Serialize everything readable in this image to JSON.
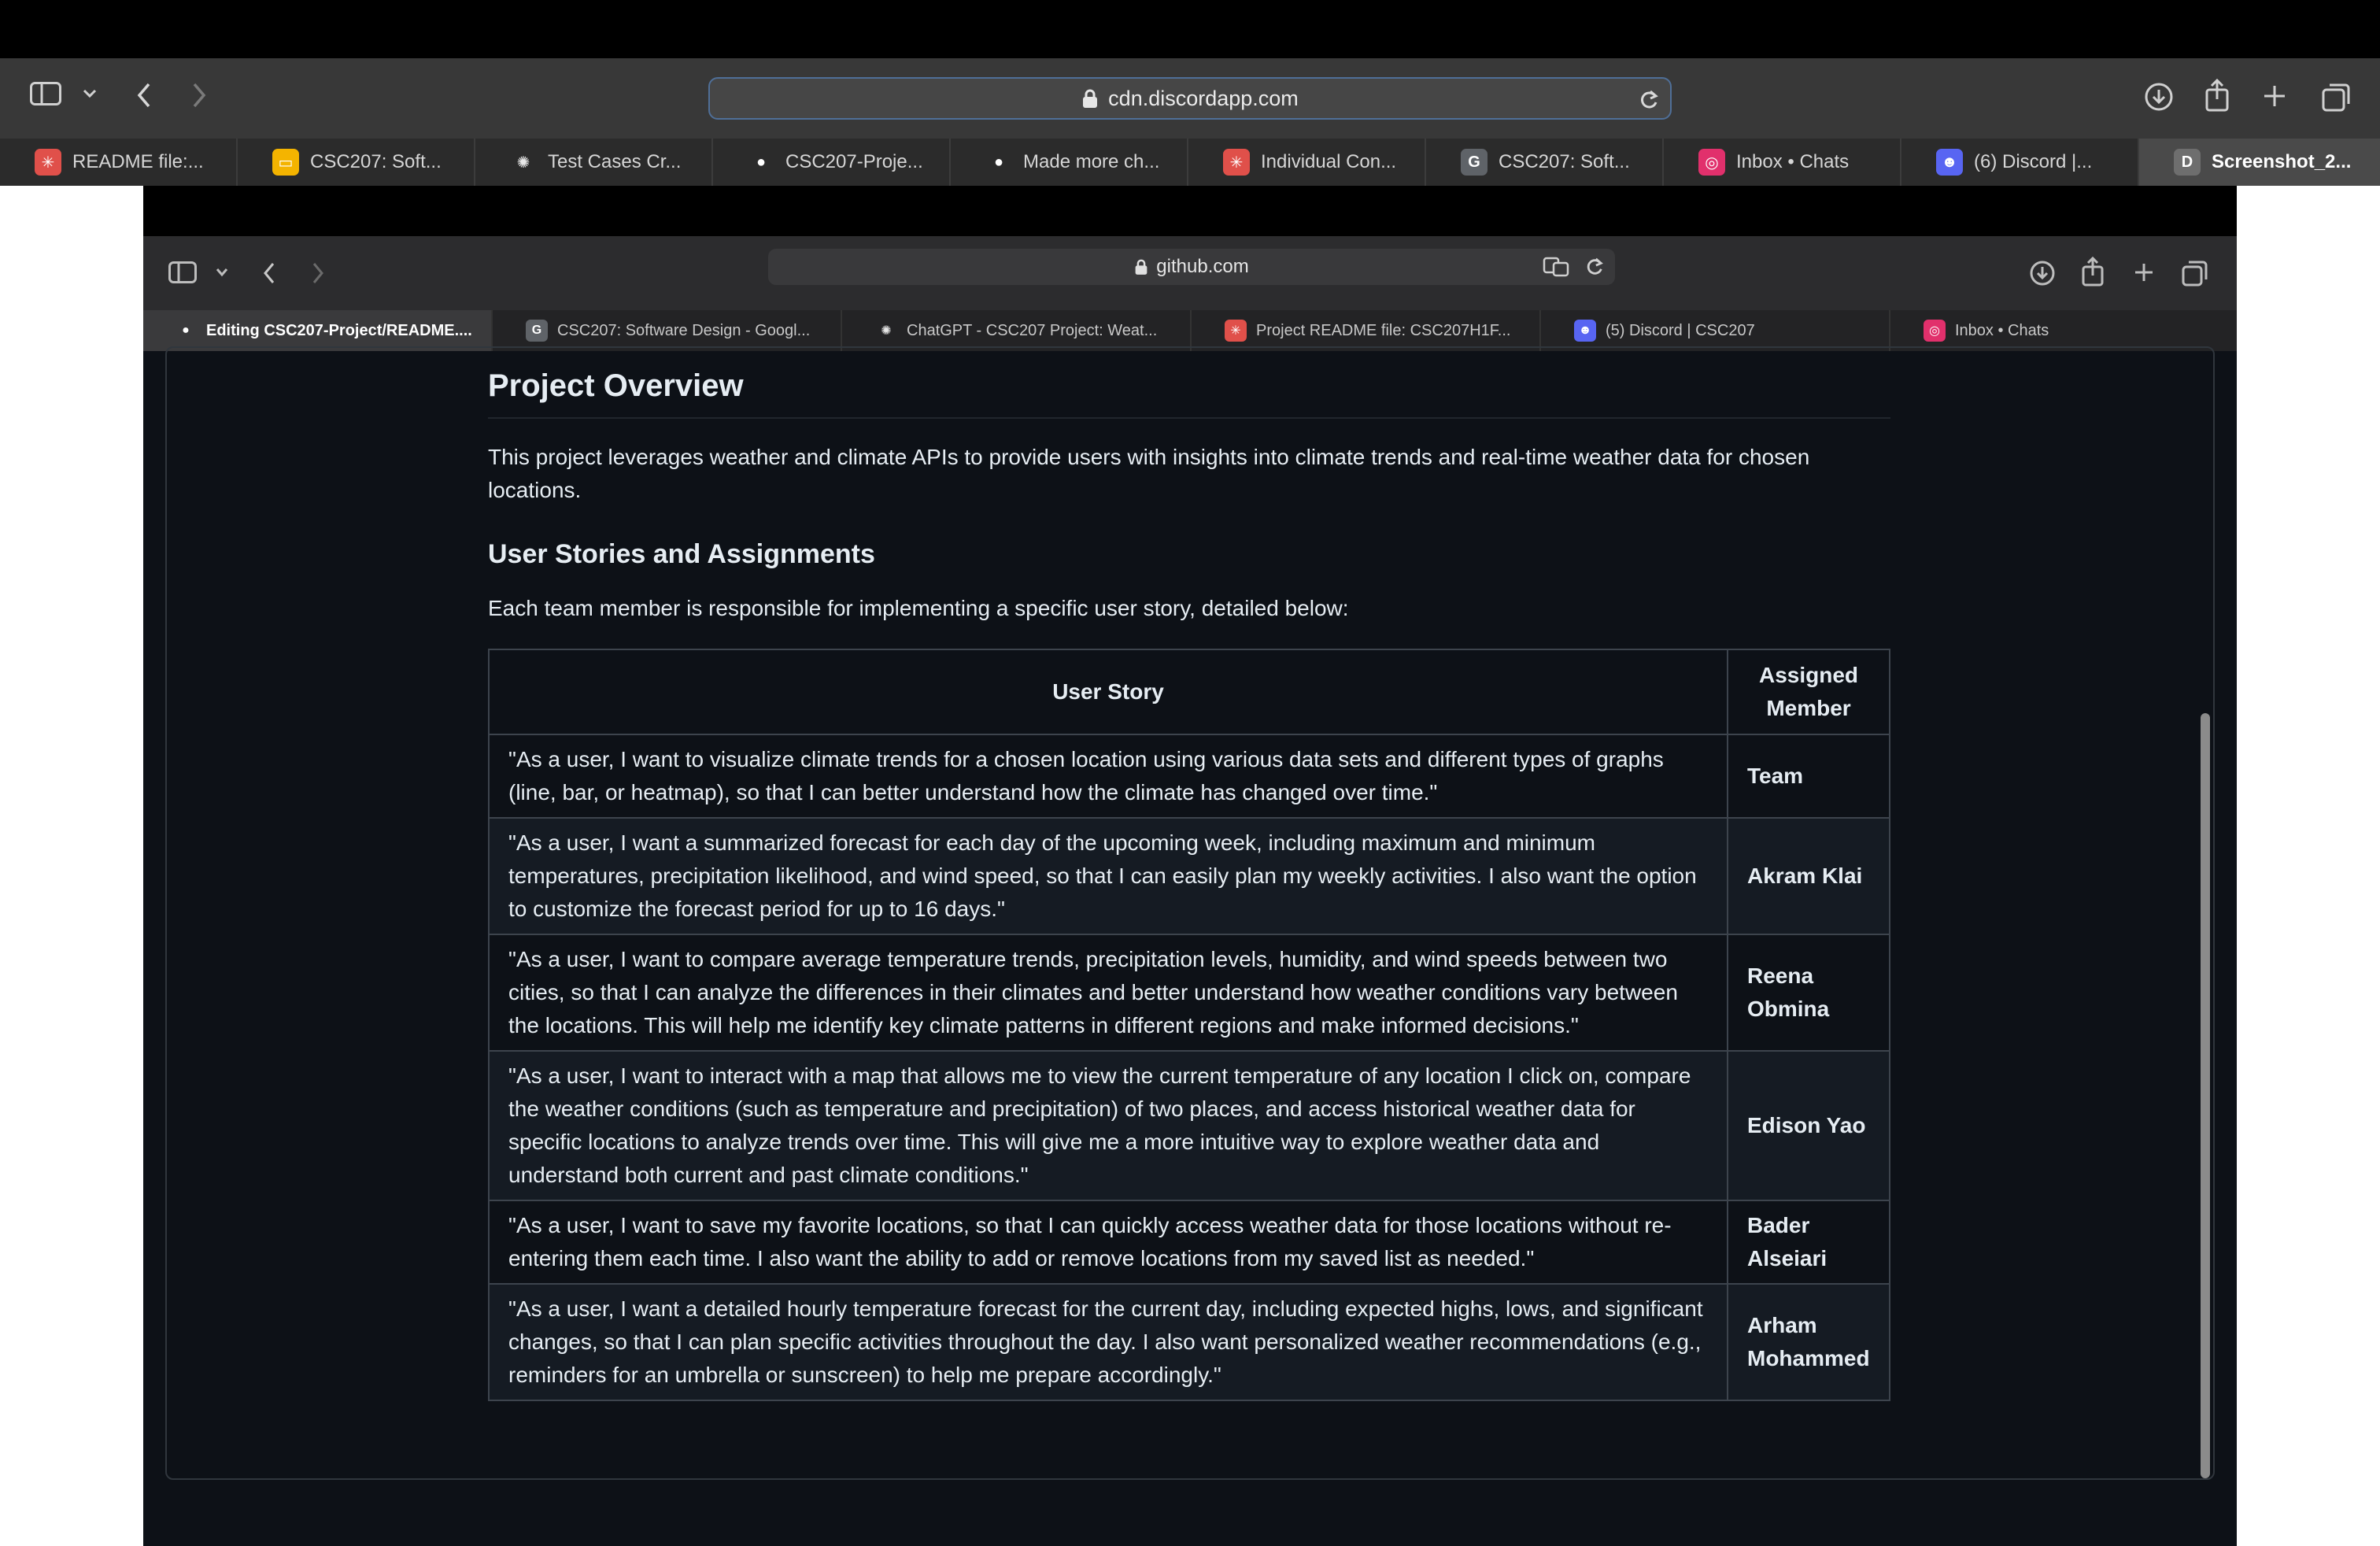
{
  "outer_browser": {
    "url": "cdn.discordapp.com",
    "tabs": [
      {
        "label": "README file:...",
        "icon": "asterisk-icon",
        "color": "#e0504a"
      },
      {
        "label": "CSC207: Soft...",
        "icon": "slides-icon",
        "color": "#f4b400"
      },
      {
        "label": "Test Cases Cr...",
        "icon": "chatgpt-icon",
        "color": "#e8e8e8"
      },
      {
        "label": "CSC207-Proje...",
        "icon": "github-icon",
        "color": "#ffffff"
      },
      {
        "label": "Made more ch...",
        "icon": "github-icon",
        "color": "#ffffff"
      },
      {
        "label": "Individual Con...",
        "icon": "asterisk-icon",
        "color": "#e0504a"
      },
      {
        "label": "CSC207: Soft...",
        "icon": "g-icon",
        "color": "#5f6368"
      },
      {
        "label": "Inbox • Chats",
        "icon": "instagram-icon",
        "color": "#e1306c"
      },
      {
        "label": "(6) Discord |...",
        "icon": "discord-icon",
        "color": "#5865f2"
      },
      {
        "label": "Screenshot_2...",
        "icon": "d-icon",
        "color": "#6e6e6e"
      }
    ]
  },
  "inner_browser": {
    "url": "github.com",
    "tabs": [
      {
        "label": "Editing CSC207-Project/README....",
        "icon": "github-icon",
        "color": "#ffffff"
      },
      {
        "label": "CSC207: Software Design - Googl...",
        "icon": "g-icon",
        "color": "#5f6368"
      },
      {
        "label": "ChatGPT - CSC207 Project: Weat...",
        "icon": "chatgpt-icon",
        "color": "#e8e8e8"
      },
      {
        "label": "Project README file: CSC207H1F...",
        "icon": "asterisk-icon",
        "color": "#e0504a"
      },
      {
        "label": "(5) Discord | CSC207",
        "icon": "discord-icon",
        "color": "#5865f2"
      },
      {
        "label": "Inbox • Chats",
        "icon": "instagram-icon",
        "color": "#e1306c"
      }
    ]
  },
  "readme": {
    "overview_heading": "Project Overview",
    "overview_text": "This project leverages weather and climate APIs to provide users with insights into climate trends and real-time weather data for chosen locations.",
    "stories_heading": "User Stories and Assignments",
    "stories_intro": "Each team member is responsible for implementing a specific user story, detailed below:",
    "table": {
      "headers": [
        "User Story",
        "Assigned Member"
      ],
      "rows": [
        {
          "story": "\"As a user, I want to visualize climate trends for a chosen location using various data sets and different types of graphs (line, bar, or heatmap), so that I can better understand how the climate has changed over time.\"",
          "member": "Team"
        },
        {
          "story": "\"As a user, I want a summarized forecast for each day of the upcoming week, including maximum and minimum temperatures, precipitation likelihood, and wind speed, so that I can easily plan my weekly activities. I also want the option to customize the forecast period for up to 16 days.\"",
          "member": "Akram Klai"
        },
        {
          "story": "\"As a user, I want to compare average temperature trends, precipitation levels, humidity, and wind speeds between two cities, so that I can analyze the differences in their climates and better understand how weather conditions vary between the locations. This will help me identify key climate patterns in different regions and make informed decisions.\"",
          "member": "Reena Obmina"
        },
        {
          "story": "\"As a user, I want to interact with a map that allows me to view the current temperature of any location I click on, compare the weather conditions (such as temperature and precipitation) of two places, and access historical weather data for specific locations to analyze trends over time. This will give me a more intuitive way to explore weather data and understand both current and past climate conditions.\"",
          "member": "Edison Yao"
        },
        {
          "story": "\"As a user, I want to save my favorite locations, so that I can quickly access weather data for those locations without re-entering them each time. I also want the ability to add or remove locations from my saved list as needed.\"",
          "member": "Bader Alseiari"
        },
        {
          "story": "\"As a user, I want a detailed hourly temperature forecast for the current day, including expected highs, lows, and significant changes, so that I can plan specific activities throughout the day. I also want personalized weather recommendations (e.g., reminders for an umbrella or sunscreen) to help me prepare accordingly.\"",
          "member": "Arham Mohammed"
        }
      ]
    }
  }
}
